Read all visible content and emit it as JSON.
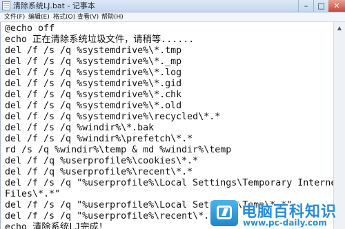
{
  "window": {
    "title": "清除系统LJ.bat - 记事本"
  },
  "controls": {
    "minimize": "–",
    "maximize": "□",
    "close": "✕"
  },
  "menu": [
    "文件(F)",
    "编辑(E)",
    "格式(O)",
    "查看(V)",
    "帮助(H)"
  ],
  "editor": {
    "lines": [
      "@echo off",
      "echo 正在清除系统垃圾文件，请稍等......",
      "del /f /s /q %systemdrive%\\*.tmp",
      "del /f /s /q %systemdrive%\\*._mp",
      "del /f /s /q %systemdrive%\\*.log",
      "del /f /s /q %systemdrive%\\*.gid",
      "del /f /s /q %systemdrive%\\*.chk",
      "del /f /s /q %systemdrive%\\*.old",
      "del /f /s /q %systemdrive%\\recycled\\*.*",
      "del /f /s /q %windir%\\*.bak",
      "del /f /s /q %windir%\\prefetch\\*.*",
      "rd /s /q %windir%\\temp & md %windir%\\temp",
      "del /f /q %userprofile%\\cookies\\*.*",
      "del /f /q %userprofile%\\recent\\*.*",
      "del /f /s /q \"%userprofile%\\Local Settings\\Temporary Internet",
      "Files\\*.*\"",
      "del /f /s /q \"%userprofile%\\Local Settings\\Temp\\*.*\"",
      "del /f /s /q \"%userprofile%\\recent\\*.*\"",
      "echo 清除系统LJ完成！"
    ]
  },
  "watermark": {
    "title": "电脑百科知识",
    "url": "www.pc-daily.com"
  }
}
